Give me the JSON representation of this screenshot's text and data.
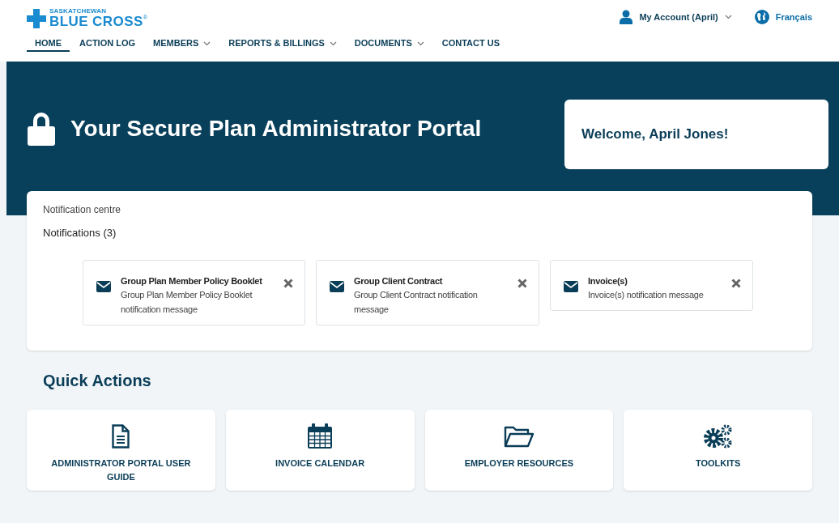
{
  "logo": {
    "subtitle": "SASKATCHEWAN",
    "name": "BLUE CROSS",
    "mark": "®"
  },
  "account_menu": {
    "label": "My Account (April)"
  },
  "language_link": {
    "label": "Français"
  },
  "nav": [
    {
      "label": "HOME",
      "selected": true,
      "dropdown": false
    },
    {
      "label": "ACTION LOG",
      "selected": false,
      "dropdown": false
    },
    {
      "label": "MEMBERS",
      "selected": false,
      "dropdown": true
    },
    {
      "label": "REPORTS & BILLINGS",
      "selected": false,
      "dropdown": true
    },
    {
      "label": "DOCUMENTS",
      "selected": false,
      "dropdown": true
    },
    {
      "label": "CONTACT US",
      "selected": false,
      "dropdown": false
    }
  ],
  "hero": {
    "title": "Your Secure Plan Administrator Portal",
    "welcome": "Welcome, April Jones!"
  },
  "notification_centre": {
    "label": "Notification centre",
    "count_label": "Notifications (3)",
    "notifications": [
      {
        "title": "Group Plan Member Policy Booklet",
        "message": "Group Plan Member Policy Booklet notification message"
      },
      {
        "title": "Group Client Contract",
        "message": "Group Client Contract notification message"
      },
      {
        "title": "Invoice(s)",
        "message": "Invoice(s) notification message"
      }
    ]
  },
  "quick_actions": {
    "title": "Quick Actions",
    "items": [
      {
        "kind": "document",
        "label": "ADMINISTRATOR PORTAL USER GUIDE"
      },
      {
        "kind": "calendar",
        "label": "INVOICE CALENDAR"
      },
      {
        "kind": "folder",
        "label": "EMPLOYER RESOURCES"
      },
      {
        "kind": "gears",
        "label": "TOOLKITS"
      }
    ]
  }
}
